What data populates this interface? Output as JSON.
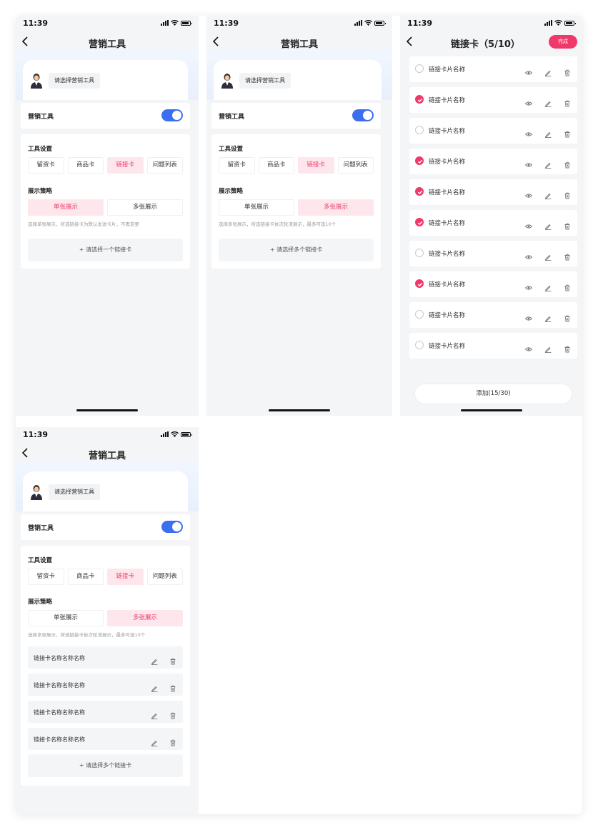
{
  "status_bar": {
    "time": "11:39"
  },
  "screen1": {
    "title": "营销工具",
    "choose_tool": "请选择营销工具",
    "toggle_label": "营销工具",
    "settings_title": "工具设置",
    "tabs": [
      "留资卡",
      "商品卡",
      "链接卡",
      "问题列表"
    ],
    "active_tab": 2,
    "strategy_title": "展示策略",
    "strategy_options": [
      "单张展示",
      "多张展示"
    ],
    "active_strategy": 0,
    "hint": "选择单张展示，所选链接卡为默认发送卡片，不再变更",
    "add_button": "+ 请选择一个链接卡"
  },
  "screen2": {
    "title": "营销工具",
    "choose_tool": "请选择营销工具",
    "toggle_label": "营销工具",
    "settings_title": "工具设置",
    "tabs": [
      "留资卡",
      "商品卡",
      "链接卡",
      "问题列表"
    ],
    "active_tab": 2,
    "strategy_title": "展示策略",
    "strategy_options": [
      "单张展示",
      "多张展示"
    ],
    "active_strategy": 1,
    "hint": "选择多张展示，所选链接卡依次轮流展示，最多可选10个",
    "add_button": "+ 请选择多个链接卡"
  },
  "screen3": {
    "title": "链接卡（5/10）",
    "done_button": "完成",
    "item_label": "链接卡片名称",
    "items_checked": [
      false,
      true,
      false,
      true,
      true,
      true,
      false,
      true,
      false,
      false
    ],
    "add_button": "添加(15/30)"
  },
  "screen4": {
    "title": "营销工具",
    "choose_tool": "请选择营销工具",
    "toggle_label": "营销工具",
    "settings_title": "工具设置",
    "tabs": [
      "留资卡",
      "商品卡",
      "链接卡",
      "问题列表"
    ],
    "active_tab": 2,
    "strategy_title": "展示策略",
    "strategy_options": [
      "单张展示",
      "多张展示"
    ],
    "active_strategy": 1,
    "hint": "选择多张展示，所选链接卡依次轮流展示，最多可选10个",
    "selected_links": [
      "链接卡名称名称名称",
      "链接卡名称名称名称",
      "链接卡名称名称名称",
      "链接卡名称名称名称"
    ],
    "add_button": "+ 请选择多个链接卡"
  },
  "colors": {
    "accent_pink": "#f0386a",
    "switch_blue": "#3a6ff0",
    "page_bg": "#f4f5f7"
  },
  "icons": [
    "back-icon",
    "signal-icon",
    "wifi-icon",
    "battery-icon",
    "avatar-icon",
    "eye-icon",
    "edit-icon",
    "trash-icon",
    "check-icon"
  ]
}
